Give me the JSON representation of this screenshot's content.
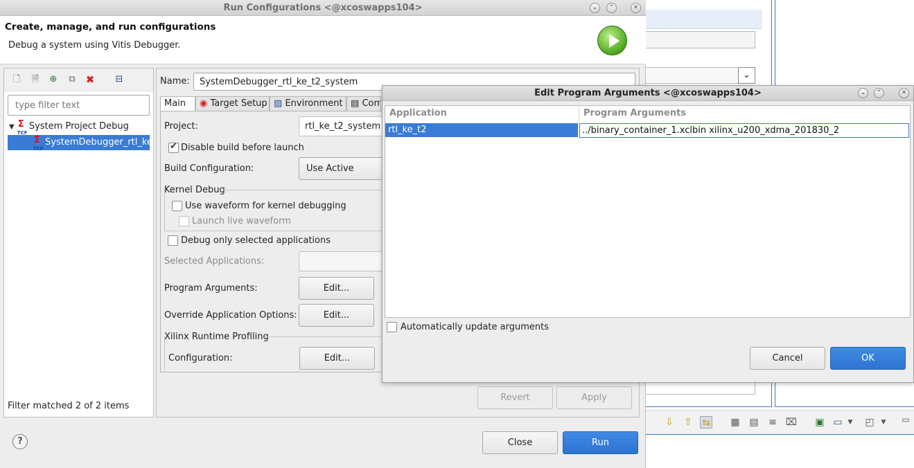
{
  "background_window": {
    "toolbar_icons": [
      "arrow-down-icon",
      "arrow-up-icon",
      "link-icon",
      "layout-icon",
      "lock-icon",
      "lines-icon",
      "clear-icon",
      "pin-icon",
      "monitor-icon",
      "chevron-down-icon",
      "new-window-icon",
      "chevron-down-icon",
      "minimize-icon"
    ]
  },
  "run_dialog": {
    "title": "Run Configurations  <@xcoswapps104>",
    "header_title": "Create, manage, and run configurations",
    "header_subtitle": "Debug a system using Vitis Debugger.",
    "filter_placeholder": "type filter text",
    "tree": {
      "parent": "System Project Debug",
      "child": "SystemDebugger_rtl_ke_t2_system"
    },
    "filter_status": "Filter matched 2 of 2 items",
    "name_label": "Name:",
    "name_value": "SystemDebugger_rtl_ke_t2_system",
    "tabs": [
      "Main",
      "Target Setup",
      "Environment",
      "Com"
    ],
    "main": {
      "project_label": "Project:",
      "project_value": "rtl_ke_t2_system",
      "disable_build_label": "Disable build before launch",
      "disable_build_checked": true,
      "build_config_label": "Build Configuration:",
      "build_config_value": "Use Active",
      "kernel_debug_label": "Kernel Debug",
      "waveform_label": "Use waveform for kernel debugging",
      "live_waveform_label": "Launch live waveform",
      "debug_selected_label": "Debug only selected applications",
      "selected_apps_label": "Selected Applications:",
      "program_args_label": "Program Arguments:",
      "override_opts_label": "Override Application Options:",
      "edit_label": "Edit...",
      "profiling_label": "Xilinx Runtime Profiling",
      "configuration_label": "Configuration:"
    },
    "revert_label": "Revert",
    "apply_label": "Apply",
    "close_label": "Close",
    "run_label": "Run",
    "help_label": "?"
  },
  "args_dialog": {
    "title": "Edit Program Arguments  <@xcoswapps104>",
    "columns": [
      "Application",
      "Program Arguments"
    ],
    "row_application": "rtl_ke_t2",
    "row_arguments": "../binary_container_1.xclbin xilinx_u200_xdma_201830_2",
    "auto_update_label": "Automatically update arguments",
    "cancel_label": "Cancel",
    "ok_label": "OK"
  },
  "colors": {
    "accent": "#3a7bd5",
    "run_icon": "#4ea51b",
    "delete_icon": "#d42020"
  }
}
